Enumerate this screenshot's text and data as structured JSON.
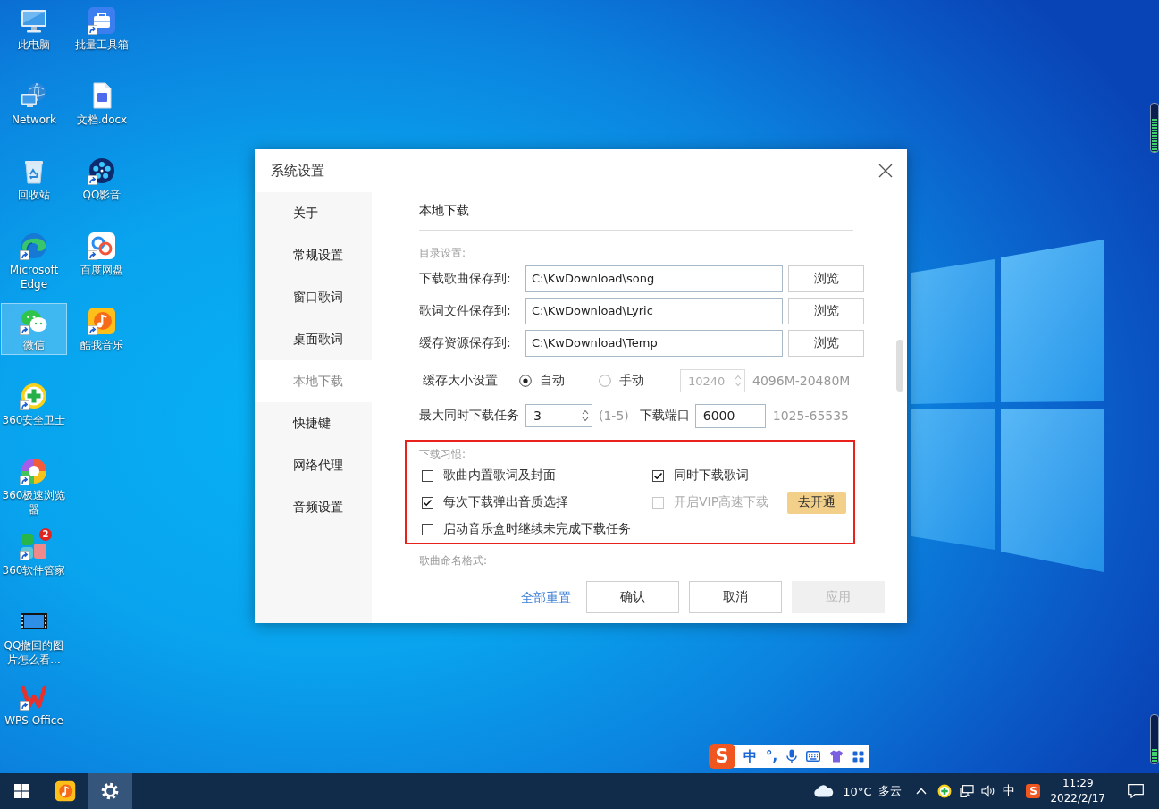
{
  "desktop_icons": [
    {
      "label": "此电脑",
      "kind": "computer",
      "shortcut": false,
      "selected": false
    },
    {
      "label": "Network",
      "kind": "network",
      "shortcut": false,
      "selected": false
    },
    {
      "label": "回收站",
      "kind": "recycle",
      "shortcut": false,
      "selected": false
    },
    {
      "label": "Microsoft Edge",
      "kind": "edge",
      "shortcut": true,
      "selected": false
    },
    {
      "label": "微信",
      "kind": "wechat",
      "shortcut": true,
      "selected": true
    },
    {
      "label": "360安全卫士",
      "kind": "guard",
      "shortcut": true,
      "selected": false
    },
    {
      "label": "360极速浏览器",
      "kind": "browser",
      "shortcut": true,
      "selected": false
    },
    {
      "label": "360软件管家",
      "kind": "manager",
      "shortcut": true,
      "selected": false,
      "badge": "2"
    },
    {
      "label": "QQ撤回的图片怎么看...",
      "kind": "video",
      "shortcut": false,
      "selected": false
    },
    {
      "label": "WPS Office",
      "kind": "wps",
      "shortcut": true,
      "selected": false
    },
    {
      "label": "批量工具箱",
      "kind": "toolbox",
      "shortcut": true,
      "selected": false
    },
    {
      "label": "文档.docx",
      "kind": "doc",
      "shortcut": false,
      "selected": false
    },
    {
      "label": "QQ影音",
      "kind": "player",
      "shortcut": true,
      "selected": false
    },
    {
      "label": "百度网盘",
      "kind": "cloud",
      "shortcut": true,
      "selected": false
    },
    {
      "label": "酷我音乐",
      "kind": "music",
      "shortcut": true,
      "selected": false
    }
  ],
  "dialog": {
    "title": "系统设置",
    "nav": [
      {
        "label": "关于",
        "selected": false
      },
      {
        "label": "常规设置",
        "selected": false
      },
      {
        "label": "窗口歌词",
        "selected": false
      },
      {
        "label": "桌面歌词",
        "selected": false
      },
      {
        "label": "本地下载",
        "selected": true
      },
      {
        "label": "快捷键",
        "selected": false
      },
      {
        "label": "网络代理",
        "selected": false
      },
      {
        "label": "音频设置",
        "selected": false
      }
    ],
    "heading": "本地下载",
    "directory": {
      "caption": "目录设置:",
      "rows": [
        {
          "label": "下载歌曲保存到:",
          "value": "C:\\KwDownload\\song",
          "button": "浏览"
        },
        {
          "label": "歌词文件保存到:",
          "value": "C:\\KwDownload\\Lyric",
          "button": "浏览"
        },
        {
          "label": "缓存资源保存到:",
          "value": "C:\\KwDownload\\Temp",
          "button": "浏览"
        }
      ]
    },
    "cache": {
      "label": "缓存大小设置",
      "options": [
        {
          "label": "自动",
          "selected": true
        },
        {
          "label": "手动",
          "selected": false
        }
      ],
      "size": {
        "value": "10240",
        "disabled": true
      },
      "range": "4096M-20480M"
    },
    "tasks": {
      "label": "最大同时下载任务",
      "value": "3",
      "range": "(1-5)"
    },
    "port": {
      "label": "下载端口",
      "value": "6000",
      "range": "1025-65535"
    },
    "habits": {
      "caption": "下载习惯:",
      "highlighted": true,
      "options": [
        {
          "label": "歌曲内置歌词及封面",
          "checked": false,
          "disabled": false
        },
        {
          "label": "同时下载歌词",
          "checked": true,
          "disabled": false
        },
        {
          "label": "每次下载弹出音质选择",
          "checked": true,
          "disabled": false
        },
        {
          "label": "开启VIP高速下载",
          "checked": false,
          "disabled": true,
          "action": "去开通"
        },
        {
          "label": "启动音乐盒时继续未完成下载任务",
          "checked": false,
          "disabled": false
        }
      ]
    },
    "naming": {
      "caption": "歌曲命名格式:"
    },
    "footer": {
      "reset": "全部重置",
      "buttons": [
        {
          "label": "确认",
          "disabled": false
        },
        {
          "label": "取消",
          "disabled": false
        },
        {
          "label": "应用",
          "disabled": true
        }
      ]
    }
  },
  "ime_bar": {
    "logo": "S",
    "mode": "中",
    "punctuation": "°,"
  },
  "gadgets": [
    {
      "level": 0.68
    },
    {
      "level": 0.3
    }
  ],
  "taskbar": {
    "apps": [
      {
        "kind": "music",
        "selected": false
      },
      {
        "kind": "settings",
        "selected": true
      }
    ],
    "weather": {
      "temperature": "10°C",
      "condition": "多云"
    },
    "ime_mode": "中",
    "ime_logo": "S",
    "time": "11:29",
    "date": "2022/2/17"
  }
}
